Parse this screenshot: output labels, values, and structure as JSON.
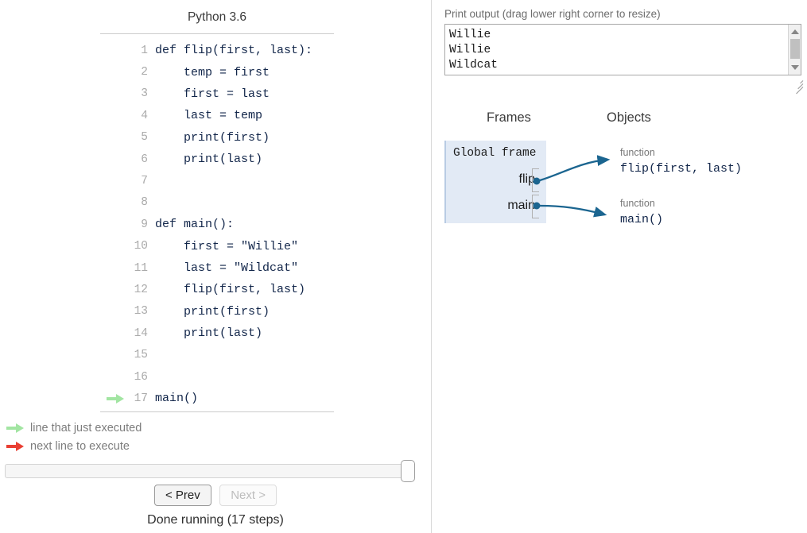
{
  "left_pane": {
    "language_title": "Python 3.6",
    "code_lines": [
      {
        "num": "1",
        "text": "def flip(first, last):",
        "arrow": "none"
      },
      {
        "num": "2",
        "text": "    temp = first",
        "arrow": "none"
      },
      {
        "num": "3",
        "text": "    first = last",
        "arrow": "none"
      },
      {
        "num": "4",
        "text": "    last = temp",
        "arrow": "none"
      },
      {
        "num": "5",
        "text": "    print(first)",
        "arrow": "none"
      },
      {
        "num": "6",
        "text": "    print(last)",
        "arrow": "none"
      },
      {
        "num": "7",
        "text": "",
        "arrow": "none"
      },
      {
        "num": "8",
        "text": "",
        "arrow": "none"
      },
      {
        "num": "9",
        "text": "def main():",
        "arrow": "none"
      },
      {
        "num": "10",
        "text": "    first = \"Willie\"",
        "arrow": "none"
      },
      {
        "num": "11",
        "text": "    last = \"Wildcat\"",
        "arrow": "none"
      },
      {
        "num": "12",
        "text": "    flip(first, last)",
        "arrow": "none"
      },
      {
        "num": "13",
        "text": "    print(first)",
        "arrow": "none"
      },
      {
        "num": "14",
        "text": "    print(last)",
        "arrow": "none"
      },
      {
        "num": "15",
        "text": "",
        "arrow": "none"
      },
      {
        "num": "16",
        "text": "",
        "arrow": "none"
      },
      {
        "num": "17",
        "text": "main()",
        "arrow": "green"
      }
    ],
    "legend": {
      "just_executed": "line that just executed",
      "next_to_execute": "next line to execute",
      "green_color": "#a2e5a2",
      "red_color": "#e93f33"
    },
    "controls": {
      "prev_label": "< Prev",
      "next_label": "Next >",
      "prev_disabled": false,
      "next_disabled": true,
      "status": "Done running (17 steps)",
      "slider_position_percent": 100
    }
  },
  "right_pane": {
    "print_output": {
      "label": "Print output (drag lower right corner to resize)",
      "text": "Willie\nWillie\nWildcat"
    },
    "frames_header": "Frames",
    "objects_header": "Objects",
    "global_frame": {
      "label": "Global frame",
      "variables": [
        {
          "name": "flip"
        },
        {
          "name": "main"
        }
      ],
      "background_color": "#e2eaf5",
      "border_color": "#b8cbe3"
    },
    "objects": [
      {
        "kind": "function",
        "value": "flip(first, last)"
      },
      {
        "kind": "function",
        "value": "main()"
      }
    ],
    "pointer_color": "#1b6590"
  }
}
